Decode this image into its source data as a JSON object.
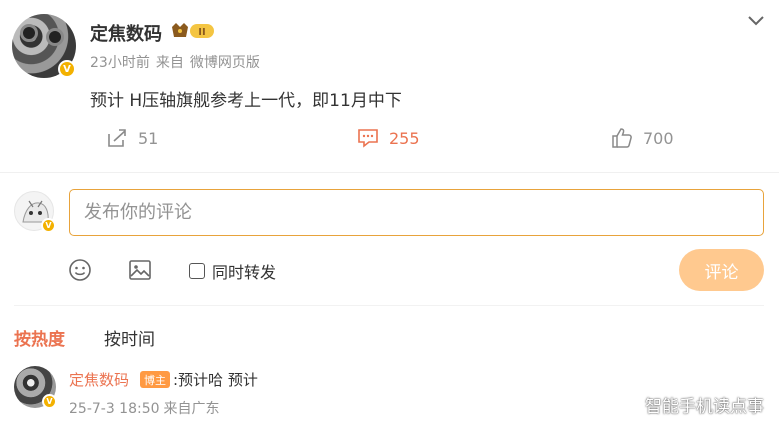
{
  "post": {
    "author": "定焦数码",
    "level_badge": "II",
    "time": "23小时前",
    "source_prefix": "来自",
    "source": "微博网页版",
    "text": "预计 H压轴旗舰参考上一代，即11月中下"
  },
  "actions": {
    "repost_count": "51",
    "comment_count": "255",
    "like_count": "700"
  },
  "composer": {
    "placeholder": "发布你的评论",
    "repost_label": "同时转发",
    "submit_label": "评论"
  },
  "sort_tabs": {
    "hot": "按热度",
    "time": "按时间"
  },
  "comments": [
    {
      "author": "定焦数码",
      "badge": "博主",
      "text": ":预计哈 预计",
      "time": "25-7-3 18:50",
      "location": "来自广东"
    }
  ],
  "watermark": "智能手机读点事",
  "colors": {
    "accent": "#eb7350",
    "submit_disabled": "#ffc98f",
    "input_border": "#e8a33b",
    "verified": "#f3b100"
  }
}
